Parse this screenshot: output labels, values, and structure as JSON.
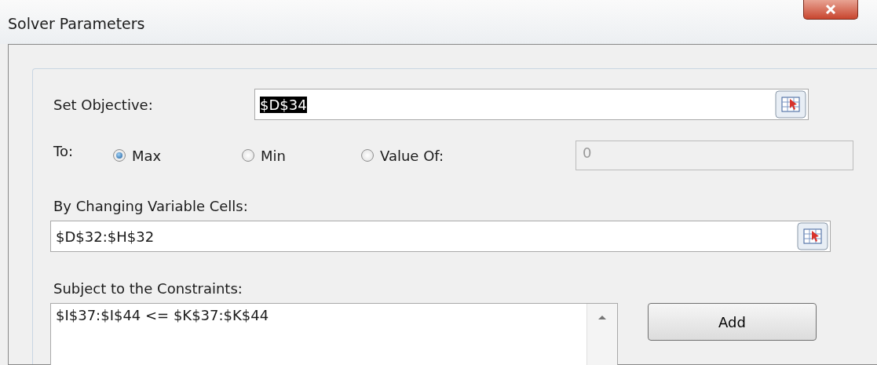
{
  "window": {
    "title": "Solver Parameters"
  },
  "objective": {
    "label": "Set Objective:",
    "value": "$D$34",
    "value_selected": true
  },
  "to": {
    "label": "To:",
    "options": [
      {
        "label": "Max",
        "selected": true
      },
      {
        "label": "Min",
        "selected": false
      },
      {
        "label": "Value Of:",
        "selected": false
      }
    ],
    "value_field": {
      "value": "0",
      "disabled": true
    }
  },
  "changing_cells": {
    "label": "By Changing Variable Cells:",
    "value": "$D$32:$H$32"
  },
  "constraints": {
    "label": "Subject to the Constraints:",
    "items": [
      "$I$37:$I$44 <= $K$37:$K$44"
    ]
  },
  "buttons": [
    "Add"
  ]
}
